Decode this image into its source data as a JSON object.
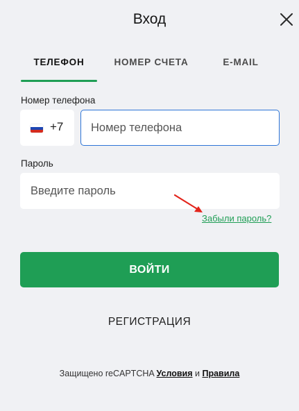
{
  "header": {
    "title": "Вход",
    "close_icon": "close-icon"
  },
  "tabs": [
    {
      "label": "ТЕЛЕФОН",
      "active": true
    },
    {
      "label": "НОМЕР СЧЕТА",
      "active": false
    },
    {
      "label": "E-MAIL",
      "active": false
    }
  ],
  "phone": {
    "label": "Номер телефона",
    "country_flag": "russia-flag-icon",
    "country_code": "+7",
    "placeholder": "Номер телефона",
    "value": ""
  },
  "password": {
    "label": "Пароль",
    "placeholder": "Введите пароль",
    "value": "",
    "forgot_label": "Забыли пароль?"
  },
  "actions": {
    "login_label": "ВОЙТИ",
    "register_label": "РЕГИСТРАЦИЯ"
  },
  "footer": {
    "protected_text": "Защищено reCAPTCHA",
    "terms_label": "Условия",
    "and_text": "и",
    "rules_label": "Правила"
  },
  "colors": {
    "background": "#f0f1f4",
    "accent": "#1f9e55",
    "focus_border": "#2d74d6",
    "annotation_arrow": "#e3241b"
  }
}
